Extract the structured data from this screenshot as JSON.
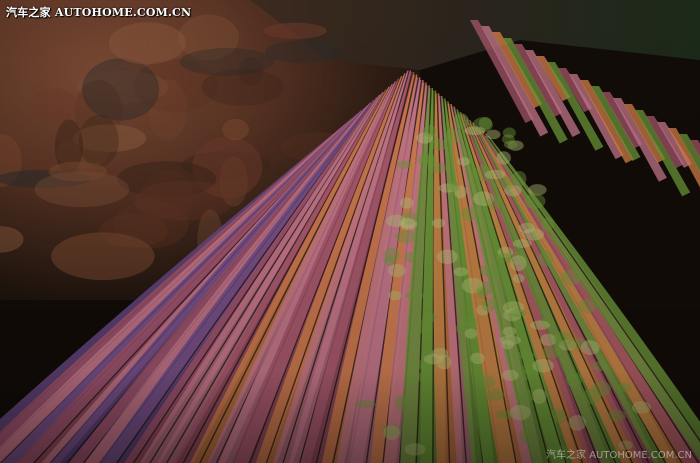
{
  "watermark": {
    "top_text": "汽车之家  AUTOHOME.COM.CN",
    "bottom_text": "汽车之家  AUTOHOME.COM.CN"
  },
  "palette": {
    "rock_dark": "#2b1f16",
    "rock_brown": "#6e3b28",
    "pink": "#c97a8e",
    "rose": "#a8576b",
    "orange": "#d9824a",
    "green": "#6f9a3a",
    "violet": "#6b4a8a"
  }
}
